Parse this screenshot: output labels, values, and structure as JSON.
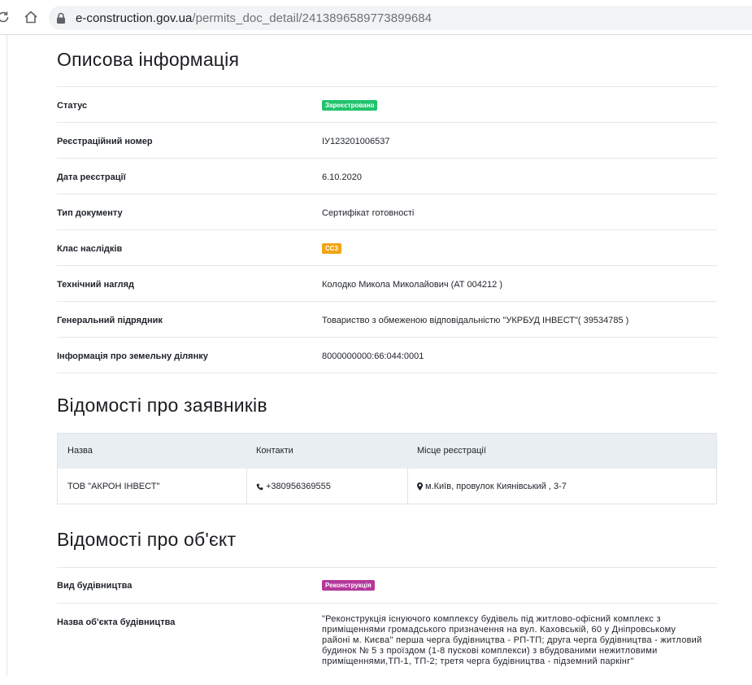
{
  "browser": {
    "url_domain": "e-construction.gov.ua",
    "url_path": "/permits_doc_detail/2413896589773899684"
  },
  "descriptive": {
    "title": "Описова інформація",
    "status_label": "Статус",
    "status_value": "Зареєстровано",
    "reg_number_label": "Реєстраційний номер",
    "reg_number_value": "ІУ123201006537",
    "reg_date_label": "Дата реєстрації",
    "reg_date_value": "6.10.2020",
    "doc_type_label": "Тип документу",
    "doc_type_value": "Сертифікат готовності",
    "consequence_label": "Клас наслідків",
    "consequence_value": "СС3",
    "supervision_label": "Технічний нагляд",
    "supervision_value": "Колодко Микола Миколайович (АТ 004212 )",
    "contractor_label": "Генеральний підрядник",
    "contractor_value": "Товариство з обмеженою відповідальністю \"УКРБУД ІНВЕСТ\"( 39534785 )",
    "land_label": "Інформація про земельну ділянку",
    "land_value": "8000000000:66:044:0001"
  },
  "applicants": {
    "title": "Відомості про заявників",
    "headers": [
      "Назва",
      "Контакти",
      "Місце реєстрації"
    ],
    "row": {
      "name": "ТОВ \"АКРОН ІНВЕСТ\"",
      "phone": "+380956369555",
      "address": "м.Київ, провулок Киянівський , 3-7"
    }
  },
  "object": {
    "title": "Відомості про об'єкт",
    "kind_label": "Вид будівництва",
    "kind_value": "Реконструкція",
    "name_label": "Назва об'єкта будівництва",
    "name_lines": [
      "\"Реконструкція існуючого комплексу будівель під житлово-офісний комплекс з",
      "приміщеннями громадського призначення на вул. Каховській, 60 у Дніпровському",
      "районі м. Києва\" перша черга будівництва - РП-ТП; друга черга будівництва - житловий",
      "будинок № 5 з проїздом (1-8 пускові комплекси) з вбудованими нежитловими",
      "приміщеннями,ТП-1, ТП-2; третя черга будівництва - підземний паркінг\""
    ]
  },
  "colors": {
    "registered": "#22c36d",
    "cc3": "#f2a516",
    "reconstruction": "#b5379c"
  },
  "icons": {
    "phone": "phone-icon",
    "location": "map-marker-icon"
  }
}
